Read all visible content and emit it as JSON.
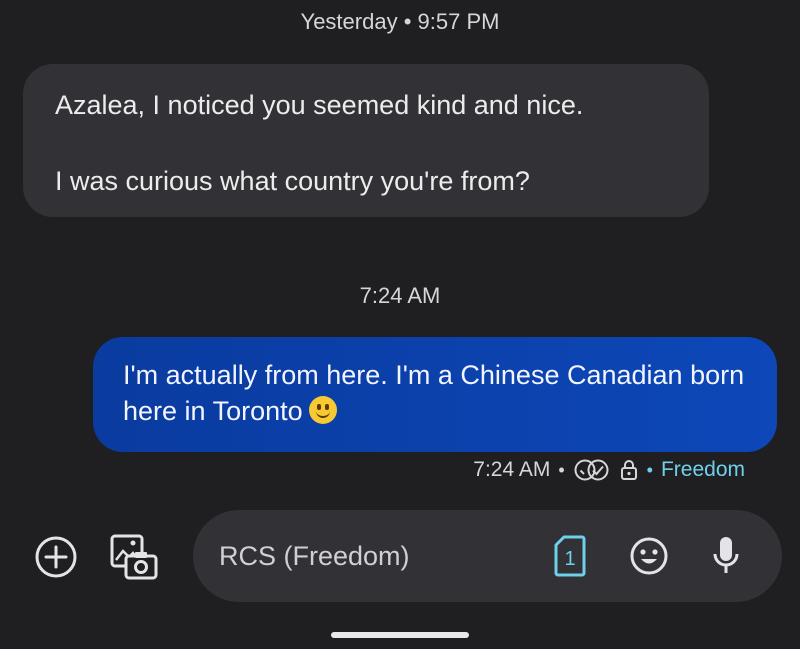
{
  "conversation": {
    "timestamp_yesterday": "Yesterday • 9:57 PM",
    "timestamp_today": "7:24 AM",
    "incoming": {
      "line1": "Azalea, I noticed you seemed kind and nice.",
      "line2": "I was curious what country you're from?"
    },
    "outgoing": {
      "text": "I'm actually from here. I'm a Chinese Canadian born here in Toronto",
      "emoji": "slightly-smiling-face"
    },
    "status": {
      "time": "7:24 AM",
      "separator": "•",
      "read_icon": "double-check-circle-icon",
      "lock_icon": "lock-icon",
      "carrier": "Freedom"
    }
  },
  "composer": {
    "placeholder": "RCS (Freedom)",
    "value": "",
    "add_icon": "add-circle-icon",
    "gallery_icon": "gallery-camera-icon",
    "sim_icon": "sim-card-icon",
    "sim_number": "1",
    "emoji_icon": "emoji-icon",
    "mic_icon": "microphone-icon"
  },
  "colors": {
    "background": "#1f1f22",
    "incoming_bubble": "#323236",
    "outgoing_bubble": "#0b3fa9",
    "accent_teal": "#6fd0ea"
  }
}
